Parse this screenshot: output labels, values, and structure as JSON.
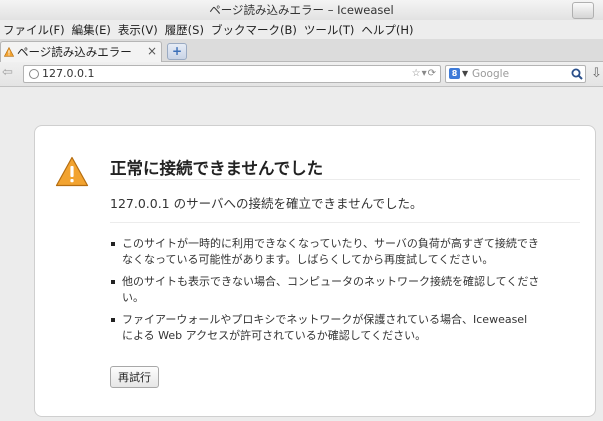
{
  "window": {
    "title": "ページ読み込みエラー – Iceweasel"
  },
  "menu": [
    "ファイル(F)",
    "編集(E)",
    "表示(V)",
    "履歴(S)",
    "ブックマーク(B)",
    "ツール(T)",
    "ヘルプ(H)"
  ],
  "tab": {
    "label": "ページ読み込みエラー",
    "new_tab": "+",
    "close": "×"
  },
  "navbar": {
    "url": "127.0.0.1",
    "search_placeholder": "Google",
    "search_engine_badge": "8"
  },
  "error": {
    "title": "正常に接続できませんでした",
    "description": "127.0.0.1 のサーバへの接続を確立できませんでした。",
    "tips": [
      "このサイトが一時的に利用できなくなっていたり、サーバの負荷が高すぎて接続できなくなっている可能性があります。しばらくしてから再度試してください。",
      "他のサイトも表示できない場合、コンピュータのネットワーク接続を確認してください。",
      "ファイアーウォールやプロキシでネットワークが保護されている場合、Iceweasel による Web アクセスが許可されているか確認してください。"
    ],
    "retry_label": "再試行"
  },
  "colors": {
    "warning": "#f2a330",
    "accent": "#3b6fb8"
  }
}
